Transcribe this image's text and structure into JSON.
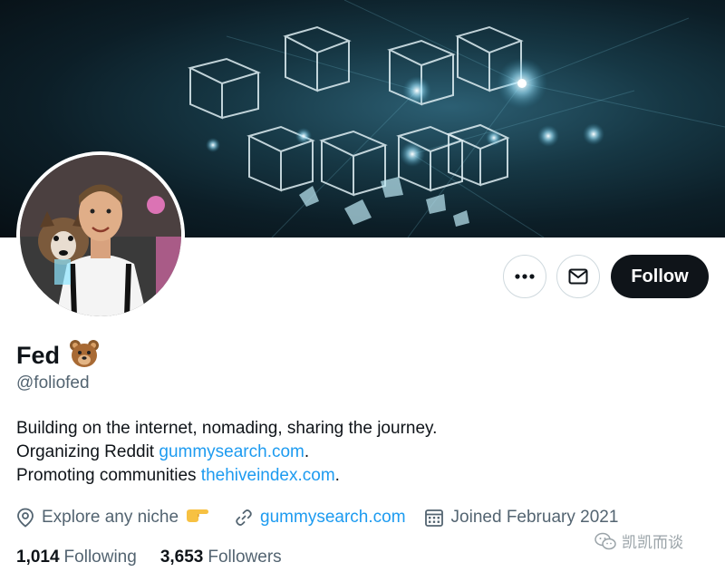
{
  "profile": {
    "display_name": "Fed",
    "name_emoji": "bear-face-emoji",
    "handle": "@foliofed",
    "bio": {
      "line1": "Building on the internet, nomading, sharing the journey.",
      "line2_prefix": "Organizing Reddit ",
      "line2_link": "gummysearch.com",
      "line2_suffix": ".",
      "line3_prefix": "Promoting communities ",
      "line3_link": "thehiveindex.com",
      "line3_suffix": "."
    },
    "location": "Explore any niche",
    "location_emoji": "backhand-index-pointing-right-emoji",
    "website": "gummysearch.com",
    "joined": "Joined February 2021",
    "stats": {
      "following_count": "1,014",
      "following_label": "Following",
      "followers_count": "3,653",
      "followers_label": "Followers"
    }
  },
  "actions": {
    "follow_label": "Follow",
    "more_icon": "more-horizontal-icon",
    "message_icon": "envelope-icon"
  },
  "watermark": {
    "text": "凯凯而谈",
    "icon": "wechat-icon"
  },
  "colors": {
    "link": "#1d9bf0",
    "text": "#0f1419",
    "secondary": "#536471",
    "follow_bg": "#0f1419"
  }
}
